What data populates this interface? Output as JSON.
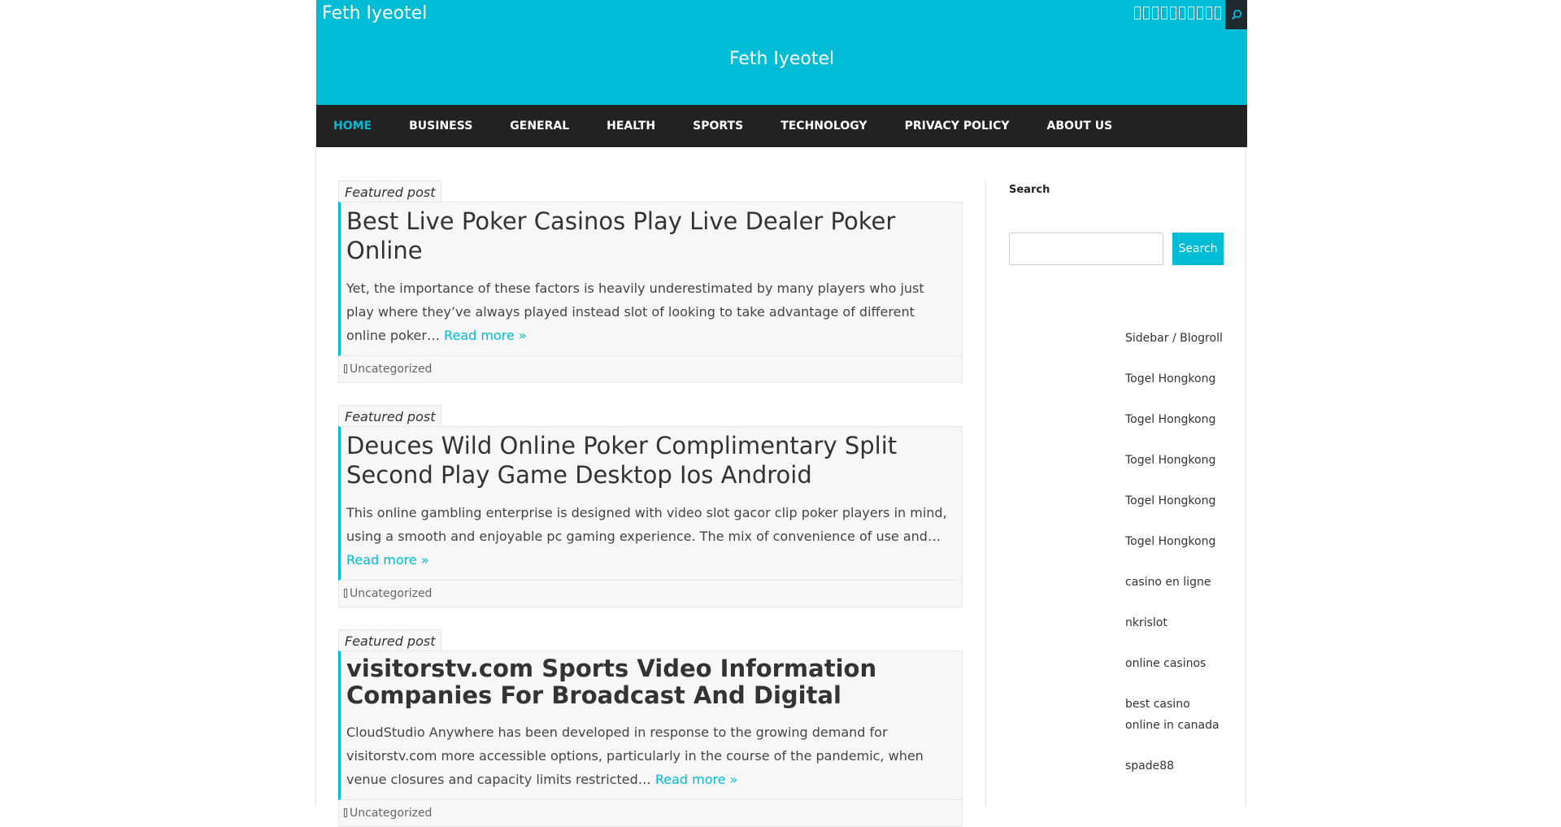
{
  "site": {
    "name_small": "Feth Iyeotel",
    "title": "Feth Iyeotel"
  },
  "icons": {
    "social": [
      "social-icon-1",
      "social-icon-2",
      "social-icon-3",
      "social-icon-4",
      "social-icon-5",
      "social-icon-6",
      "social-icon-7",
      "social-icon-8",
      "social-icon-9",
      "social-icon-10"
    ],
    "search": "search-icon"
  },
  "colors": {
    "accent": "#00bcd4",
    "nav_bg": "#222222",
    "search_toggle_bg": "#1f2a30"
  },
  "nav": {
    "items": [
      "HOME",
      "BUSINESS",
      "GENERAL",
      "HEALTH",
      "SPORTS",
      "TECHNOLOGY",
      "PRIVACY POLICY",
      "ABOUT US"
    ],
    "active": "HOME"
  },
  "posts": [
    {
      "tag": "Featured post",
      "title": "Best Live Poker Casinos Play Live Dealer Poker Online",
      "excerpt": "Yet, the importance of these factors is heavily underestimated by many players who just play where they’ve always played instead slot of looking to take advantage of different online poker…",
      "read_more": "Read more »",
      "category": "Uncategorized"
    },
    {
      "tag": "Featured post",
      "title": "Deuces Wild Online Poker Complimentary Split Second Play Game Desktop Ios Android",
      "excerpt": "This online gambling enterprise is designed with video slot gacor clip poker players in mind, using a smooth and enjoyable pc gaming experience. The mix of convenience of use and…",
      "read_more": "Read more »",
      "category": "Uncategorized"
    },
    {
      "tag": "Featured post",
      "title": "visitorstv.com Sports Video Information Companies For Broadcast And Digital",
      "excerpt": "CloudStudio Anywhere has been developed in response to the growing demand for visitorstv.com more accessible options, particularly in the course of the pandemic, when venue closures and capacity limits restricted…",
      "read_more": "Read more »",
      "category": "Uncategorized"
    }
  ],
  "sidebar": {
    "search_title": "Search",
    "search_button": "Search",
    "search_value": "",
    "blogroll": [
      "Sidebar / Blogroll",
      "Togel Hongkong",
      "Togel Hongkong",
      "Togel Hongkong",
      "Togel Hongkong",
      "Togel Hongkong",
      "casino en ligne",
      "nkrislot",
      "online casinos",
      "best casino online in canada",
      "spade88"
    ]
  }
}
